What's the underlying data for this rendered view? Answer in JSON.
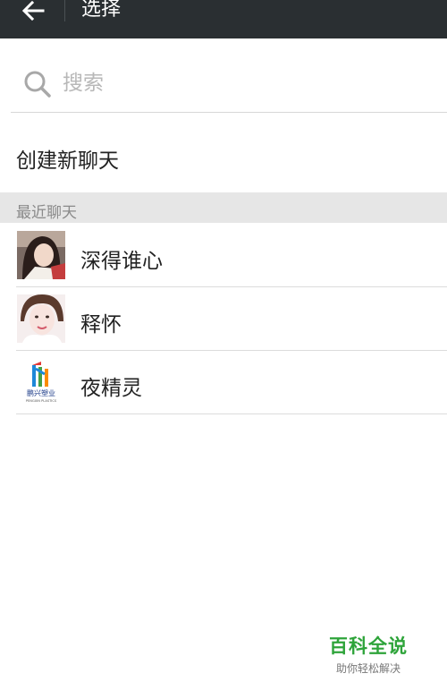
{
  "topbar": {
    "back_icon": "arrow-left-icon",
    "title": "选择"
  },
  "search": {
    "icon": "search-icon",
    "placeholder": "搜索",
    "value": ""
  },
  "new_chat": {
    "label": "创建新聊天"
  },
  "recent": {
    "header": "最近聊天",
    "items": [
      {
        "name": "深得谁心",
        "avatar": "photo-avatar-woman-dark-hair"
      },
      {
        "name": "释怀",
        "avatar": "photo-avatar-woman-light"
      },
      {
        "name": "夜精灵",
        "avatar": "logo-avatar-pengxing",
        "avatar_text": "鹏兴塑业",
        "avatar_subtext": "PENGXIN PLASTICS"
      }
    ]
  },
  "watermark": {
    "title": "百科全说",
    "subtitle": "助你轻松解决",
    "color": "#2ea43a"
  },
  "colors": {
    "topbar": "#2a2f32",
    "section_bg": "#e6e6e6"
  }
}
